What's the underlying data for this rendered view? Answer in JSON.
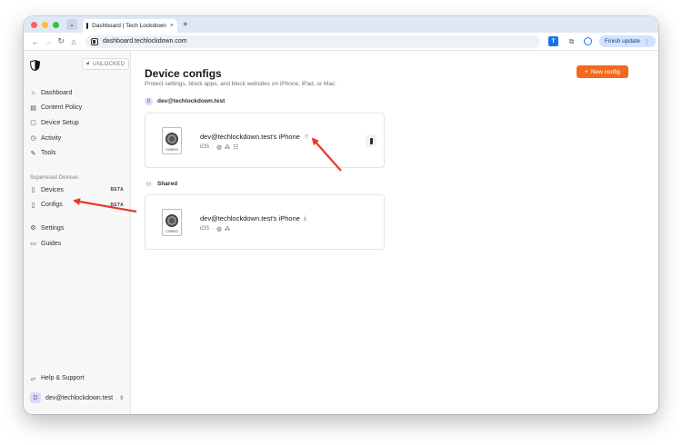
{
  "browser": {
    "tab_title": "Dashboard | Tech Lockdown",
    "tab_close": "×",
    "new_tab": "+",
    "url": "dashboard.techlockdown.com",
    "finish_update_label": "Finish update",
    "more_glyph": "⋮"
  },
  "sidebar": {
    "lock_badge": "UNLOCKED",
    "items": [
      {
        "label": "Dashboard",
        "icon": "home-icon"
      },
      {
        "label": "Content Policy",
        "icon": "document-icon"
      },
      {
        "label": "Device Setup",
        "icon": "setup-icon"
      },
      {
        "label": "Activity",
        "icon": "activity-icon"
      },
      {
        "label": "Tools",
        "icon": "wrench-icon"
      }
    ],
    "section_supervised": "Supervised Devices",
    "supervised_items": [
      {
        "label": "Devices",
        "badge": "BETA",
        "icon": "devices-icon"
      },
      {
        "label": "Configs",
        "badge": "BETA",
        "icon": "config-icon"
      }
    ],
    "bottom_items": [
      {
        "label": "Settings",
        "icon": "gear-icon"
      },
      {
        "label": "Guides",
        "icon": "book-icon"
      }
    ],
    "help_label": "Help & Support",
    "user_initial": "D",
    "user_email": "dev@techlockdown.test"
  },
  "main": {
    "title": "Device configs",
    "subtitle": "Protect settings, block apps, and block websites on iPhone, iPad, or Mac.",
    "new_config_label": "New config",
    "groups": [
      {
        "name": "dev@techlockdown.test",
        "initial": "D",
        "card": {
          "title": "dev@techlockdown.test's iPhone",
          "platform": "iOS",
          "file_label": "CONFIG"
        }
      },
      {
        "name": "Shared",
        "card": {
          "title": "dev@techlockdown.test's iPhone",
          "platform": "iOS",
          "file_label": "CONFIG"
        }
      }
    ]
  },
  "colors": {
    "accent": "#f26b1d",
    "arrow": "#e53b2c"
  }
}
